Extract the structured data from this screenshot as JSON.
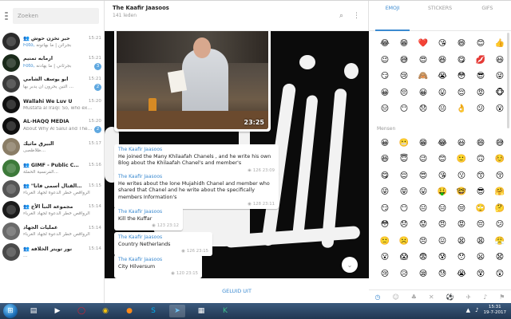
{
  "chat_list": {
    "search_placeholder": "Zoeken",
    "chats": [
      {
        "name": "حبر تخزن حوش",
        "time": "15:21",
        "author": "Foto,",
        "preview": "بجراثن | ما بهاتونه",
        "badge": "",
        "badge_color": "",
        "avatar_color": "#2b2b2b",
        "group": true
      },
      {
        "name": "ارمابه تمنيم",
        "time": "15:21",
        "author": "Foto,",
        "preview": "بجرثاني | ما يهادنه",
        "badge": "3",
        "badge_color": "#5fa8e0",
        "avatar_color": "#1a2a1a",
        "group": false
      },
      {
        "name": "أبو يوسف الشامي",
        "time": "15:21",
        "author": "",
        "preview": "التين يحرون أن يدبر بها ...",
        "badge": "2",
        "badge_color": "#5fa8e0",
        "avatar_color": "#3a3a3a",
        "group": false
      },
      {
        "name": "Wallahi We Luv U",
        "time": "15:20",
        "author": "",
        "preview": "Mustafa al Iraqi: So, who exa...",
        "badge": "",
        "badge_color": "",
        "avatar_color": "#111111",
        "group": false
      },
      {
        "name": "AL-HAQQ MEDIA",
        "time": "15:20",
        "author": "",
        "preview": "About Why Al Salul and There ...",
        "badge": "2",
        "badge_color": "#5fa8e0",
        "avatar_color": "#0f0f0f",
        "group": false
      },
      {
        "name": "البيرق ماثيك",
        "time": "15:17",
        "author": "",
        "preview": "ظلاظصى...",
        "badge": "",
        "badge_color": "",
        "avatar_color": "#8a7d66",
        "group": false
      },
      {
        "name": "GIMF - Public Cha...",
        "time": "15:16",
        "author": "",
        "preview": "الفرنسية الحملة...",
        "badge": "",
        "badge_color": "",
        "avatar_color": "#3d7a3a",
        "group": true
      },
      {
        "name": "\"والقتال أسمى فانا\"",
        "time": "15:15",
        "author": "",
        "preview": "الرواقص خطر الدعوة لجهاد الغرباء",
        "badge": "",
        "badge_color": "",
        "avatar_color": "#555555",
        "group": true
      },
      {
        "name": "مجموعة النبأ الأخ",
        "time": "15:14",
        "author": "",
        "preview": "الرواقص خطر الدعوة لجهاد الغرباء",
        "badge": "",
        "badge_color": "",
        "avatar_color": "#1b1b1b",
        "group": true
      },
      {
        "name": "عمليات الجهاد",
        "time": "15:14",
        "author": "",
        "preview": "الرواقص خطر الدعوة لجهاد الغرباء",
        "badge": "",
        "badge_color": "",
        "avatar_color": "#6a6a6a",
        "group": false
      },
      {
        "name": "نور تويتر الخلافة",
        "time": "15:14",
        "author": "",
        "preview": "...",
        "badge": "",
        "badge_color": "",
        "avatar_color": "#4a4a4a",
        "group": true
      }
    ]
  },
  "conversation": {
    "title": "The Kaafir Jaasoos",
    "subtitle": "141 leden",
    "video_time": "23:25",
    "footer_button": "GELUID UIT",
    "messages": [
      {
        "sender": "The Kaafir Jaasoos",
        "text": "He joined the Many Khilaafah Chanels , and he write his own Blog about the Khilaafah Chanel's and member's",
        "views": "126",
        "time": "23:09"
      },
      {
        "sender": "The Kaafir Jaasoos",
        "text": "He writes about the lone Mujahidh Chanel and member who shared that Chanel and he write about the specifically members Information's",
        "views": "128",
        "time": "23:11"
      },
      {
        "sender": "The Kaafir Jaasoos",
        "text": "Kill the  Kuffar",
        "views": "123",
        "time": "23:12"
      },
      {
        "sender": "The Kaafir Jaasoos",
        "text": "Country Netherlands",
        "views": "126",
        "time": "23:15"
      },
      {
        "sender": "The Kaafir Jaasoos",
        "text": "City Hilversum",
        "views": "120",
        "time": "23:15"
      }
    ]
  },
  "emoji_panel": {
    "tabs": [
      "EMOJI",
      "STICKERS",
      "GIFS"
    ],
    "active_tab": 0,
    "section_label": "Mensen",
    "recent": [
      "😂",
      "😁",
      "❤️",
      "😘",
      "😄",
      "😊",
      "👍",
      "😉",
      "😅",
      "😍",
      "😆",
      "😋",
      "💋",
      "😃",
      "😏",
      "😢",
      "🙈",
      "😭",
      "😳",
      "😎",
      "😜",
      "😀",
      "😔",
      "😀",
      "😛",
      "😌",
      "😡",
      "🐵",
      "😑",
      "😶",
      "😞",
      "😐",
      "👌",
      "😕",
      "😮"
    ],
    "people": [
      "😀",
      "😬",
      "😁",
      "😂",
      "😃",
      "😄",
      "😅",
      "😆",
      "😇",
      "😉",
      "😊",
      "🙂",
      "🙃",
      "☺️",
      "😋",
      "😌",
      "😍",
      "😘",
      "😗",
      "😙",
      "😚",
      "😜",
      "😝",
      "😛",
      "🤑",
      "🤓",
      "😎",
      "🤗",
      "😏",
      "😶",
      "😐",
      "😑",
      "😒",
      "🙄",
      "🤔",
      "😳",
      "😞",
      "😟",
      "😠",
      "😡",
      "😔",
      "😕",
      "🙁",
      "☹️",
      "😣",
      "😖",
      "😫",
      "😩",
      "😤",
      "😮",
      "😱",
      "😨",
      "😰",
      "😯",
      "😦",
      "😧",
      "😢",
      "😥",
      "😪",
      "😓",
      "😭",
      "😵",
      "😲",
      "🤐",
      "😷",
      "🤒",
      "🤕",
      "😴",
      "💤",
      "💩"
    ],
    "categories": [
      "clock-icon",
      "smile-icon",
      "leaf-icon",
      "food-icon",
      "ball-icon",
      "plane-icon",
      "bell-icon",
      "flag-icon"
    ],
    "active_category": 0
  },
  "taskbar": {
    "time": "15:31",
    "date": "19-7-2017",
    "apps": [
      "explorer-icon",
      "media-icon",
      "opera-icon",
      "chrome-icon",
      "firefox-icon",
      "skype-icon",
      "telegram-icon",
      "files-icon",
      "kaspersky-icon"
    ],
    "active_app": 6
  },
  "colors": {
    "accent": "#3b8ad0",
    "badge": "#5fa8e0",
    "taskbar": "#2b4665"
  }
}
